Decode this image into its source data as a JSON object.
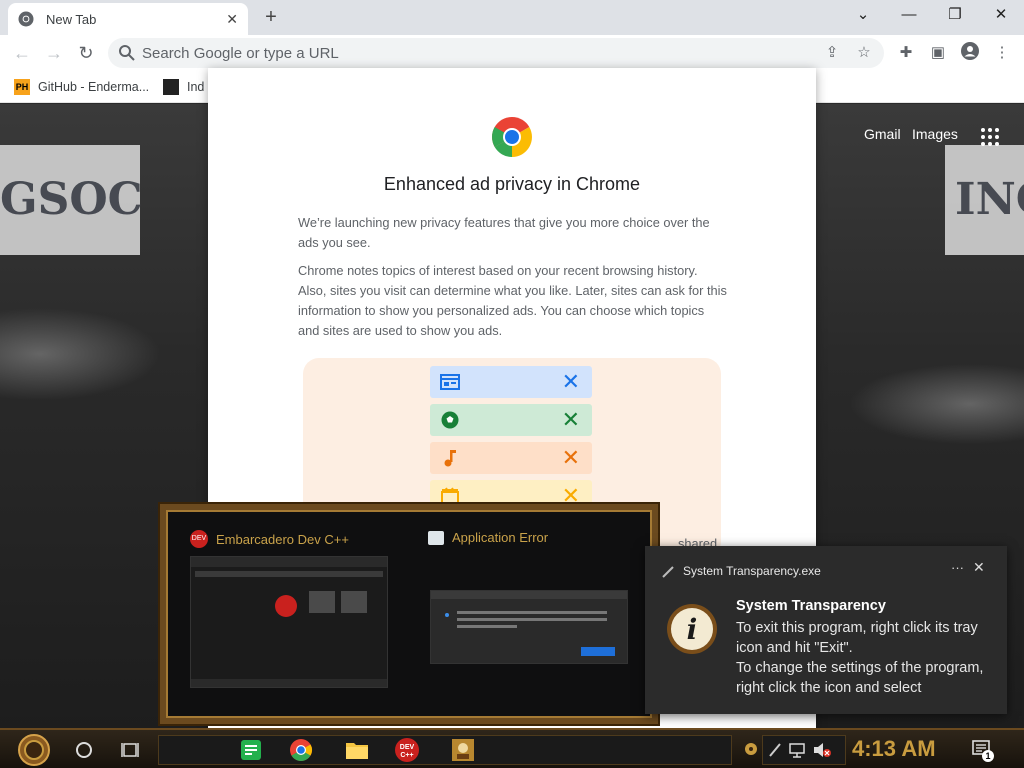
{
  "browser": {
    "tab_title": "New Tab",
    "omnibox_placeholder": "Search Google or type a URL",
    "bookmarks": [
      {
        "icon_text": "PH",
        "label": "GitHub - Enderma..."
      },
      {
        "icon_text": "",
        "label": "Ind"
      }
    ],
    "window_controls": [
      "chevron-down",
      "minimize",
      "restore",
      "close"
    ]
  },
  "google_page": {
    "links": [
      "Gmail",
      "Images"
    ],
    "banner_left": "GSOC",
    "banner_right": "INC"
  },
  "privacy_dialog": {
    "title": "Enhanced ad privacy in Chrome",
    "para1": "We’re launching new privacy features that give you more choice over the ads you see.",
    "para2": "Chrome notes topics of interest based on your recent browsing history. Also, sites you visit can determine what you like. Later, sites can ask for this information to show you personalized ads. You can choose which topics and sites are used to show you ads.",
    "bottom_partial": "shared",
    "illustration_rows": [
      {
        "icon": "web-icon",
        "color": "#1a73e8",
        "bg": "#d2e3fc"
      },
      {
        "icon": "soccer-ball-icon",
        "color": "#188038",
        "bg": "#ceead6"
      },
      {
        "icon": "music-note-icon",
        "color": "#e8710a",
        "bg": "#fedfc8"
      },
      {
        "icon": "clapperboard-icon",
        "color": "#f9ab00",
        "bg": "#feefc3"
      }
    ]
  },
  "task_preview": {
    "items": [
      {
        "title": "Embarcadero Dev C++",
        "icon": "devcpp-icon"
      },
      {
        "title": "Application Error",
        "icon": "window-icon"
      }
    ]
  },
  "notification": {
    "app_name": "System Transparency.exe",
    "title": "System Transparency",
    "body": "To exit this program, right click its tray icon and hit \"Exit\".\nTo change the settings of the program, right click the icon and select"
  },
  "taskbar": {
    "clock": "4:13 AM",
    "notification_count": "1",
    "pinned": [
      "notes-icon",
      "chrome-icon",
      "file-explorer-icon",
      "devcpp-icon",
      "game-icon"
    ]
  }
}
